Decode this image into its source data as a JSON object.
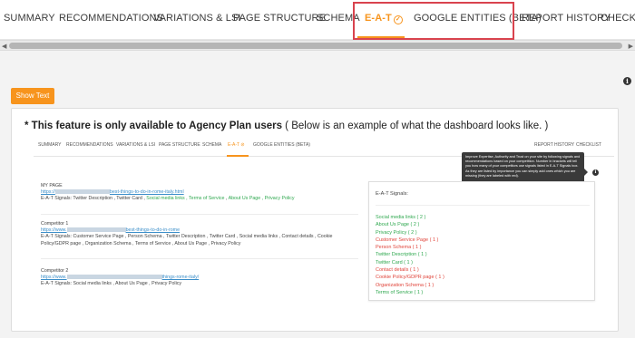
{
  "nav": {
    "tabs": [
      {
        "label": "SUMMARY",
        "active": false
      },
      {
        "label": "RECOMMENDATIONS",
        "active": false
      },
      {
        "label": "VARIATIONS & LSI",
        "active": false
      },
      {
        "label": "PAGE STRUCTURE",
        "active": false
      },
      {
        "label": "SCHEMA",
        "active": false
      },
      {
        "label": "E-A-T",
        "active": true,
        "icon": "check-circle-icon"
      },
      {
        "label": "GOOGLE ENTITIES (BETA)",
        "active": false
      },
      {
        "label": "REPORT HISTORY",
        "active": false
      },
      {
        "label": "CHECKLI",
        "active": false
      }
    ]
  },
  "show_text_label": "Show Text",
  "notice": {
    "strong": "* This feature is only available to Agency Plan users",
    "rest": " ( Below is an example of what the dashboard looks like. )"
  },
  "mock": {
    "tabs": [
      {
        "label": "SUMMARY"
      },
      {
        "label": "RECOMMENDATIONS"
      },
      {
        "label": "VARIATIONS & LSI"
      },
      {
        "label": "PAGE STRUCTURE"
      },
      {
        "label": "SCHEMA"
      },
      {
        "label": "E-A-T ⊘"
      },
      {
        "label": "GOOGLE ENTITIES (BETA)"
      },
      {
        "label": "REPORT HISTORY"
      },
      {
        "label": "CHECKLIST"
      }
    ],
    "tooltip": "Improve Expertise, Authority and Trust on your site by following signals and recommendations based on your competition. Number in brackets will tell you how many of your competitors use signals listed in E-A-T Signals box. As they are listed by importance you can simply add ones which you are missing (they are labeled with red).",
    "sites": [
      {
        "name": "MY PAGE",
        "url_prefix": "https://",
        "url_suffix": "best-things-to-do-in-rome-italy.html",
        "signals_prefix": "E-A-T Signals: Twitter Description , Twitter Card , ",
        "signals_green": "Social media links , Terms of Service",
        "signals_mid": " , ",
        "signals_green2": "About Us Page , Privacy Policy"
      },
      {
        "name": "Competitor 1",
        "url_prefix": "https://www.",
        "url_suffix": "best-things-to-do-in-rome",
        "signals": "E-A-T Signals: Customer Service Page , Person Schema , Twitter Description , Twitter Card , Social media links , Contact details , Cookie Policy/GDPR page , Organization Schema , Terms of Service , About Us Page , Privacy Policy"
      },
      {
        "name": "Competitor 2",
        "url_prefix": "https://www.",
        "url_suffix": "things-rome-italy/",
        "signals": "E-A-T Signals: Social media links , About Us Page , Privacy Policy"
      }
    ],
    "signals_box": {
      "title": "E-A-T Signals:",
      "items": [
        {
          "label": "Social media links ( 2 )",
          "status": "present"
        },
        {
          "label": "About Us Page ( 2 )",
          "status": "present"
        },
        {
          "label": "Privacy Policy ( 2 )",
          "status": "present"
        },
        {
          "label": "Customer Service Page ( 1 )",
          "status": "missing"
        },
        {
          "label": "Person Schema ( 1 )",
          "status": "missing"
        },
        {
          "label": "Twitter Description ( 1 )",
          "status": "present"
        },
        {
          "label": "Twitter Card ( 1 )",
          "status": "present"
        },
        {
          "label": "Contact details ( 1 )",
          "status": "missing"
        },
        {
          "label": "Cookie Policy/GDPR page ( 1 )",
          "status": "missing"
        },
        {
          "label": "Organization Schema ( 1 )",
          "status": "missing"
        },
        {
          "label": "Terms of Service ( 1 )",
          "status": "present"
        }
      ]
    }
  },
  "colors": {
    "accent": "#f7941d",
    "highlight_border": "#d9434e",
    "present": "#2fa84f",
    "missing": "#e0443a",
    "link": "#3b8ec9"
  }
}
